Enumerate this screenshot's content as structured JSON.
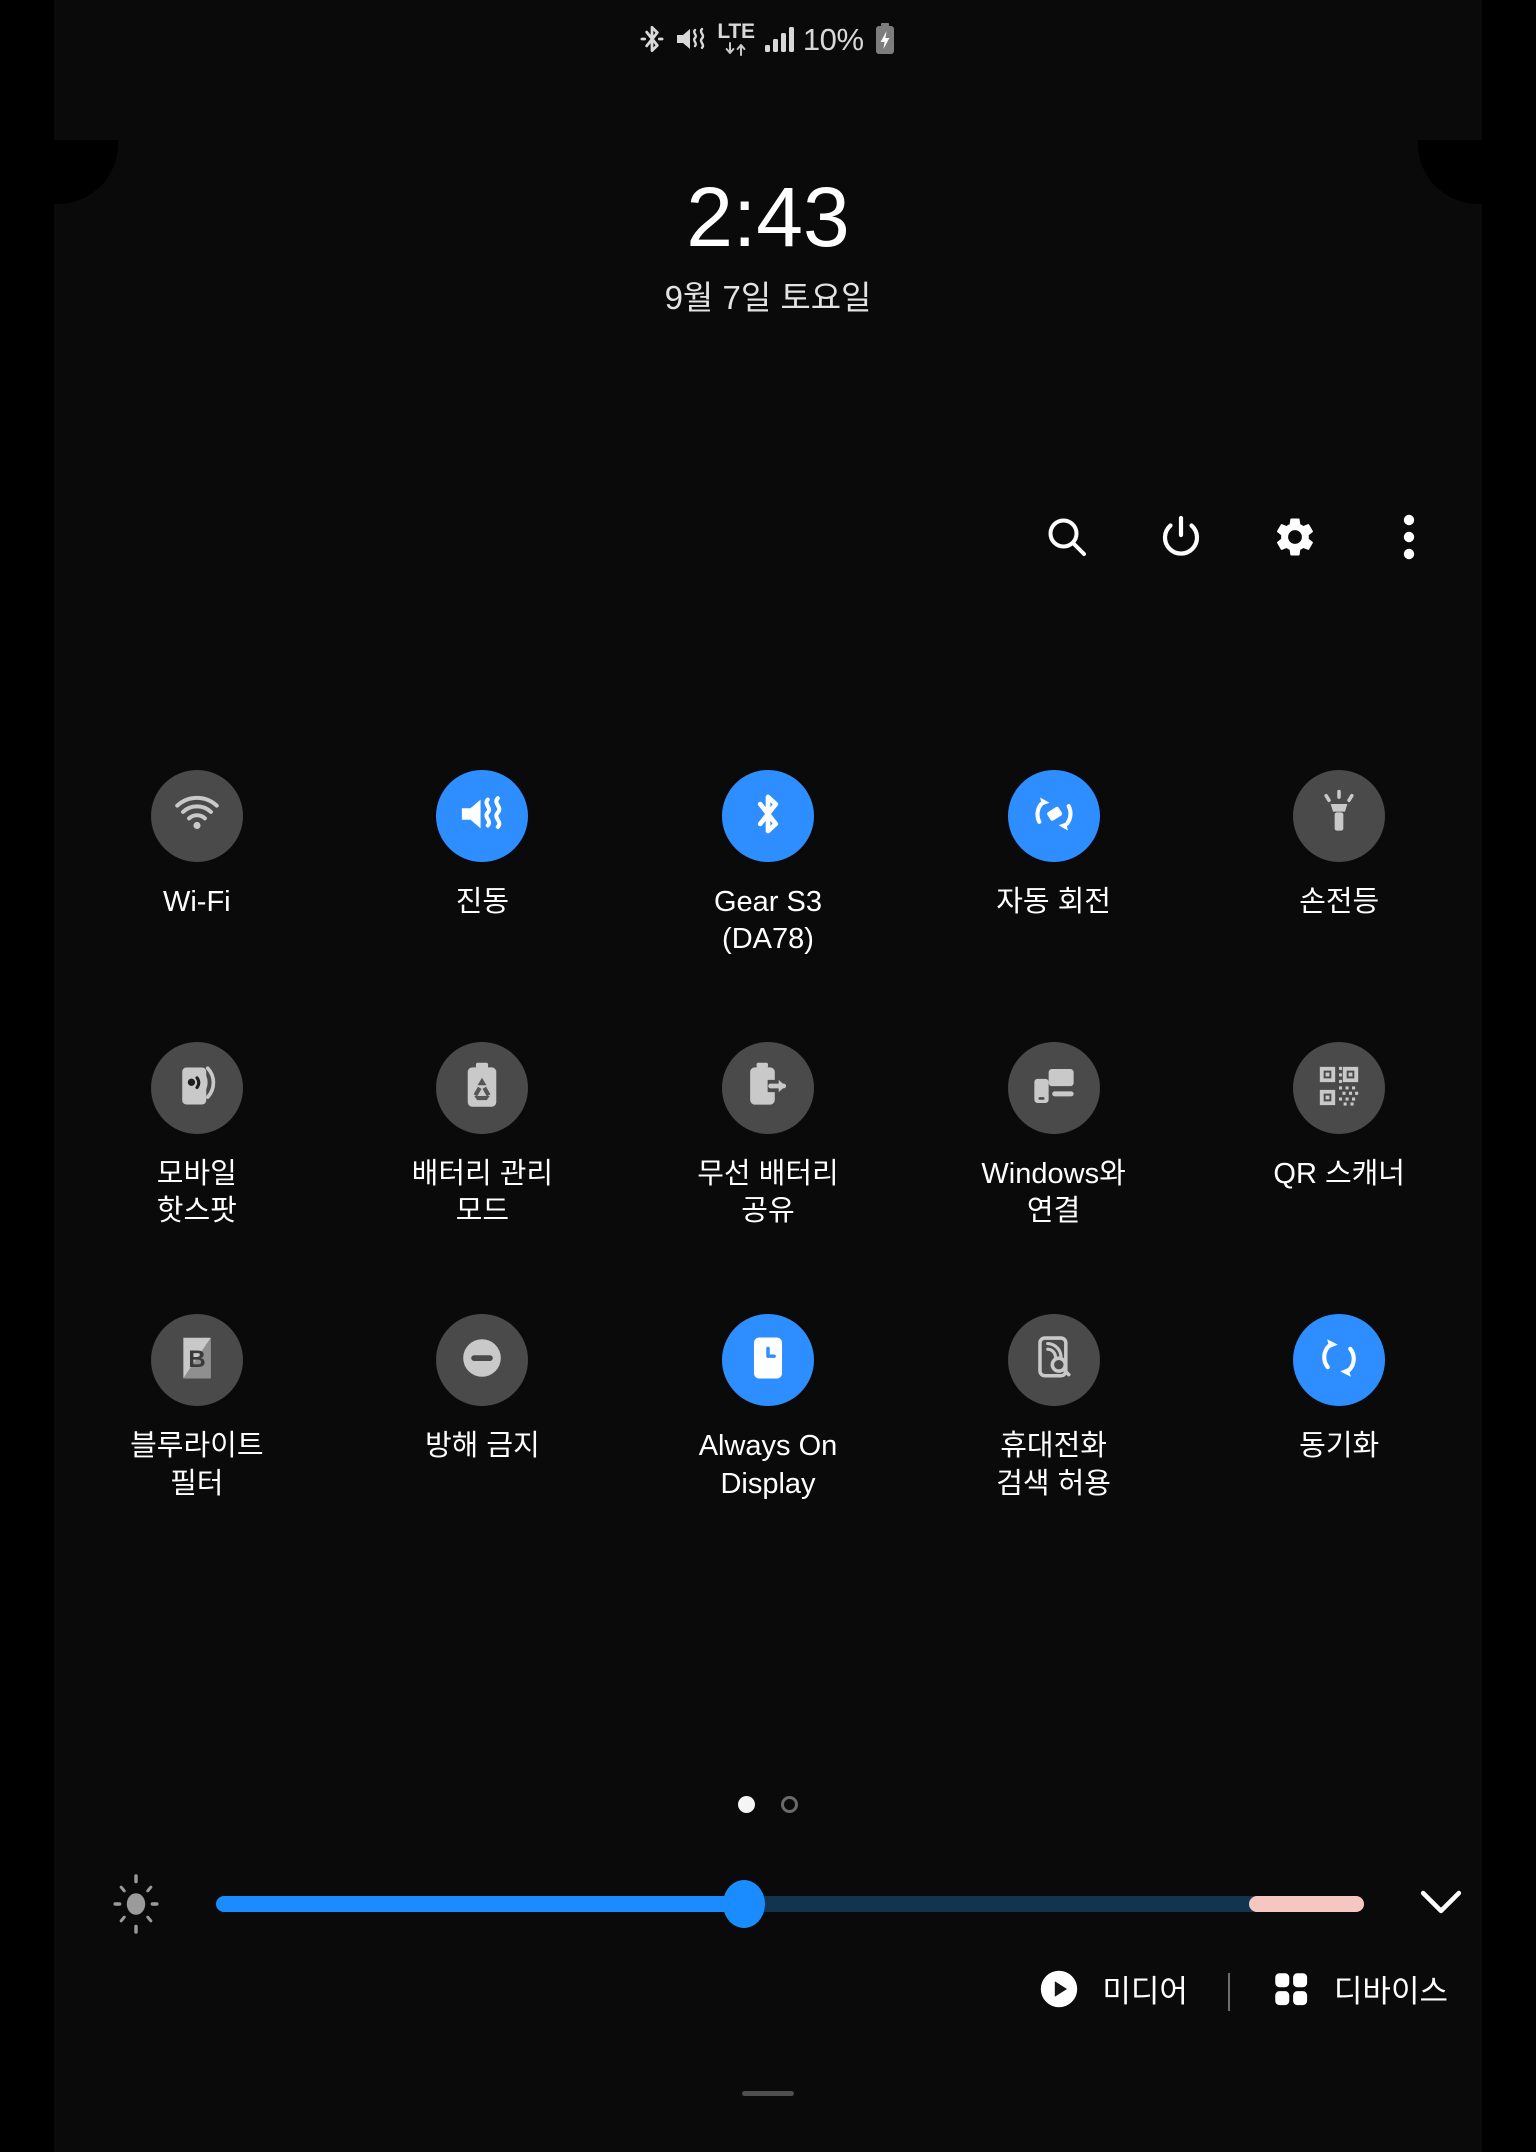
{
  "status_bar": {
    "icons": [
      "bluetooth-icon",
      "sound-vibrate-off-icon",
      "lte-icon",
      "signal-bars-icon"
    ],
    "network_label": "LTE",
    "battery_percent": "10%",
    "battery_state": "charging"
  },
  "clock": {
    "time": "2:43",
    "date": "9월 7일 토요일"
  },
  "header_actions": [
    {
      "name": "search-button",
      "icon": "search-icon"
    },
    {
      "name": "power-button",
      "icon": "power-icon"
    },
    {
      "name": "settings-button",
      "icon": "gear-icon"
    },
    {
      "name": "more-options-button",
      "icon": "overflow-menu-icon"
    }
  ],
  "quick_settings": {
    "tiles": [
      {
        "label": "Wi-Fi",
        "icon": "wifi-icon",
        "state": "off"
      },
      {
        "label": "진동",
        "icon": "vibrate-icon",
        "state": "on"
      },
      {
        "label": "Gear S3\n(DA78)",
        "icon": "bluetooth-icon",
        "state": "on"
      },
      {
        "label": "자동 회전",
        "icon": "auto-rotate-icon",
        "state": "on"
      },
      {
        "label": "손전등",
        "icon": "flashlight-icon",
        "state": "off"
      },
      {
        "label": "모바일\n핫스팟",
        "icon": "mobile-hotspot-icon",
        "state": "off"
      },
      {
        "label": "배터리 관리\n모드",
        "icon": "battery-care-icon",
        "state": "off"
      },
      {
        "label": "무선 배터리\n공유",
        "icon": "wireless-powershare-icon",
        "state": "off"
      },
      {
        "label": "Windows와\n연결",
        "icon": "link-to-windows-icon",
        "state": "off"
      },
      {
        "label": "QR 스캐너",
        "icon": "qr-scanner-icon",
        "state": "off"
      },
      {
        "label": "블루라이트\n필터",
        "icon": "blue-light-filter-icon",
        "state": "off"
      },
      {
        "label": "방해 금지",
        "icon": "do-not-disturb-icon",
        "state": "off"
      },
      {
        "label": "Always On\nDisplay",
        "icon": "always-on-display-icon",
        "state": "on"
      },
      {
        "label": "휴대전화\n검색 허용",
        "icon": "find-my-mobile-icon",
        "state": "off"
      },
      {
        "label": "동기화",
        "icon": "sync-icon",
        "state": "on"
      }
    ]
  },
  "pager": {
    "total_pages": 2,
    "active_page": 1
  },
  "brightness": {
    "icon": "brightness-icon",
    "value_percent": 46,
    "limit_start_percent": 90,
    "expand_icon": "chevron-down-icon"
  },
  "bottom_bar": {
    "media_label": "미디어",
    "media_icon": "play-circle-icon",
    "devices_label": "디바이스",
    "devices_icon": "devices-grid-icon"
  },
  "colors": {
    "accent_on": "#2e8eff",
    "tile_off": "#4a4a4a",
    "slider_fill": "#1a8cff",
    "slider_track": "#11354f",
    "slider_limit": "#f6c6c0",
    "background": "#0a0a0a",
    "text_primary": "#ffffff"
  }
}
